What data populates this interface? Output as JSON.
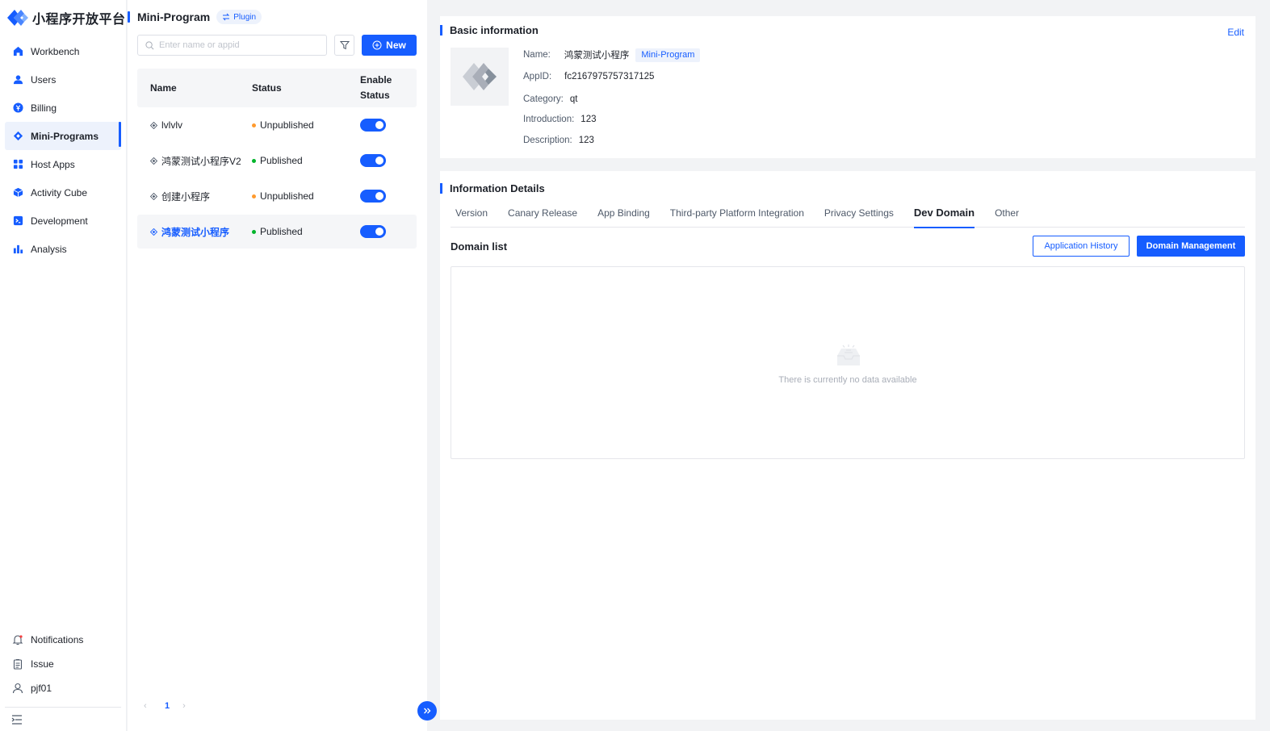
{
  "brand": {
    "name": "小程序开放平台"
  },
  "sidebar": {
    "items": [
      {
        "label": "Workbench",
        "icon": "home-icon"
      },
      {
        "label": "Users",
        "icon": "user-icon"
      },
      {
        "label": "Billing",
        "icon": "billing-icon"
      },
      {
        "label": "Mini-Programs",
        "icon": "diamond-icon",
        "active": true
      },
      {
        "label": "Host Apps",
        "icon": "grid-icon"
      },
      {
        "label": "Activity Cube",
        "icon": "cube-icon"
      },
      {
        "label": "Development",
        "icon": "terminal-icon"
      },
      {
        "label": "Analysis",
        "icon": "bar-chart-icon"
      }
    ],
    "bottom": [
      {
        "label": "Notifications",
        "icon": "bell-icon"
      },
      {
        "label": "Issue",
        "icon": "clipboard-icon"
      },
      {
        "label": "pjf01",
        "icon": "person-icon"
      }
    ]
  },
  "list_panel": {
    "title": "Mini-Program",
    "plugin_tag": "Plugin",
    "search_placeholder": "Enter name or appid",
    "new_button": "New",
    "columns": {
      "name": "Name",
      "status": "Status",
      "enable_line1": "Enable",
      "enable_line2": "Status"
    },
    "rows": [
      {
        "name": "lvlvlv",
        "status": "Unpublished",
        "status_color": "#ff9a2e",
        "enabled": true
      },
      {
        "name": "鸿蒙测试小程序V2",
        "status": "Published",
        "status_color": "#00b42a",
        "enabled": true
      },
      {
        "name": "创建小程序",
        "status": "Unpublished",
        "status_color": "#ff9a2e",
        "enabled": true
      },
      {
        "name": "鸿蒙测试小程序",
        "status": "Published",
        "status_color": "#00b42a",
        "enabled": true,
        "selected": true
      }
    ],
    "pagination": {
      "prev": "‹",
      "page": "1",
      "next": "›"
    }
  },
  "basic_info": {
    "title": "Basic information",
    "edit": "Edit",
    "name_label": "Name:",
    "name": "鸿蒙测试小程序",
    "type_tag": "Mini-Program",
    "appid_label": "AppID:",
    "appid": "fc2167975757317125",
    "category_label": "Category:",
    "category": "qt",
    "intro_label": "Introduction:",
    "intro": "123",
    "desc_label": "Description:",
    "desc": "123"
  },
  "details": {
    "title": "Information Details",
    "tabs": [
      "Version",
      "Canary Release",
      "App Binding",
      "Third-party Platform Integration",
      "Privacy Settings",
      "Dev Domain",
      "Other"
    ],
    "active_tab": "Dev Domain",
    "domain_list_title": "Domain list",
    "history_button": "Application History",
    "manage_button": "Domain Management",
    "empty_text": "There is currently no data available"
  },
  "colors": {
    "primary": "#165dff",
    "published": "#00b42a",
    "unpublished": "#ff9a2e"
  }
}
